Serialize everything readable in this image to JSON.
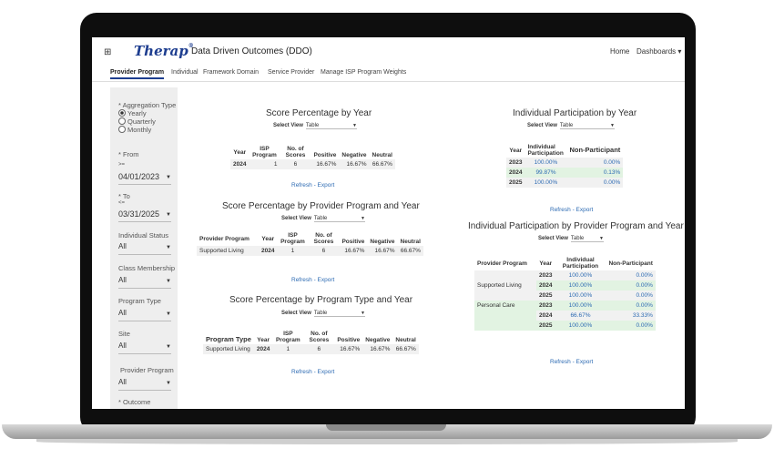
{
  "header": {
    "logo": "Therap",
    "logo_mark": "®",
    "title": "Data Driven Outcomes (DDO)",
    "home": "Home",
    "dashboards": "Dashboards ▾"
  },
  "tabs": [
    "Provider Program",
    "Individual",
    "Framework Domain",
    "Service Provider",
    "Manage ISP Program Weights"
  ],
  "sidebar": {
    "aggregation_label": "* Aggregation Type",
    "aggregation_options": [
      "Yearly",
      "Quarterly",
      "Monthly"
    ],
    "aggregation_selected": "Yearly",
    "from_label": "* From",
    "from_op": ">=",
    "from_value": "04/01/2023",
    "to_label": "* To",
    "to_op": "<=",
    "to_value": "03/31/2025",
    "individual_status_label": "Individual Status",
    "individual_status_value": "All",
    "class_membership_label": "Class Membership",
    "class_membership_value": "All",
    "program_type_label": "Program Type",
    "program_type_value": "All",
    "site_label": "Site",
    "site_value": "All",
    "provider_program_label": "Provider Program",
    "provider_program_value": "All",
    "outcome_label": "* Outcome"
  },
  "select_view": {
    "label": "Select View",
    "value": "Table"
  },
  "refresh_export": "Refresh - Export",
  "score_by_year": {
    "title": "Score Percentage by Year",
    "headers": [
      "Year",
      "ISP Program",
      "No. of Scores",
      "Positive",
      "Negative",
      "Neutral"
    ],
    "rows": [
      [
        "2024",
        "1",
        "6",
        "16.67%",
        "16.67%",
        "66.67%"
      ]
    ]
  },
  "score_by_provider": {
    "title": "Score Percentage by Provider Program and Year",
    "headers": [
      "Provider Program",
      "Year",
      "ISP Program",
      "No. of Scores",
      "Positive",
      "Negative",
      "Neutral"
    ],
    "rows": [
      [
        "Supported Living",
        "2024",
        "1",
        "6",
        "16.67%",
        "16.67%",
        "66.67%"
      ]
    ]
  },
  "score_by_program_type": {
    "title": "Score Percentage by Program Type and Year",
    "headers": [
      "Program Type",
      "Year",
      "ISP Program",
      "No. of Scores",
      "Positive",
      "Negative",
      "Neutral"
    ],
    "rows": [
      [
        "Supported Living",
        "2024",
        "1",
        "6",
        "16.67%",
        "16.67%",
        "66.67%"
      ]
    ]
  },
  "participation_by_year": {
    "title": "Individual Participation by Year",
    "headers": [
      "Year",
      "Individual Participation",
      "Non-Participant"
    ],
    "rows": [
      [
        "2023",
        "100.00%",
        "0.00%"
      ],
      [
        "2024",
        "99.87%",
        "0.13%"
      ],
      [
        "2025",
        "100.00%",
        "0.00%"
      ]
    ]
  },
  "participation_by_provider": {
    "title": "Individual Participation by Provider Program and Year",
    "headers": [
      "Provider Program",
      "Year",
      "Individual Participation",
      "Non-Participant"
    ],
    "groups": [
      {
        "program": "Supported Living",
        "rows": [
          [
            "2023",
            "100.00%",
            "0.00%"
          ],
          [
            "2024",
            "100.00%",
            "0.00%"
          ],
          [
            "2025",
            "100.00%",
            "0.00%"
          ]
        ]
      },
      {
        "program": "Personal Care",
        "rows": [
          [
            "2023",
            "100.00%",
            "0.00%"
          ],
          [
            "2024",
            "66.67%",
            "33.33%"
          ],
          [
            "2025",
            "100.00%",
            "0.00%"
          ]
        ]
      }
    ]
  }
}
